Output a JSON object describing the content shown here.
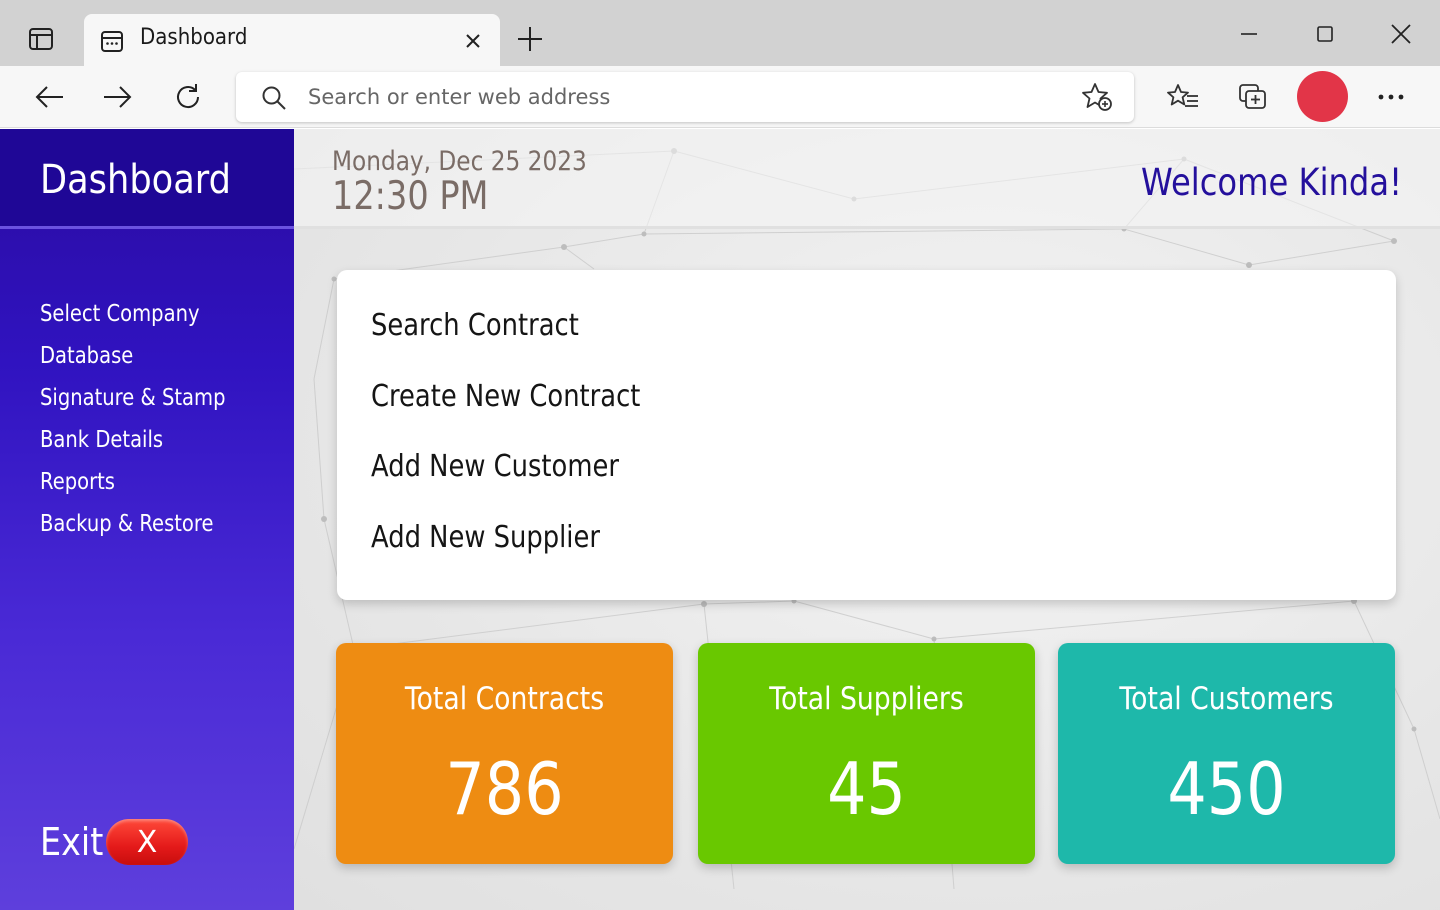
{
  "browser": {
    "tab_title": "Dashboard",
    "address_placeholder": "Search or enter web address",
    "profile_color": "#e23548"
  },
  "sidebar": {
    "title": "Dashboard",
    "items": [
      {
        "label": "Select Company"
      },
      {
        "label": "Database"
      },
      {
        "label": "Signature & Stamp"
      },
      {
        "label": "Bank Details"
      },
      {
        "label": "Reports"
      },
      {
        "label": "Backup & Restore"
      }
    ],
    "exit_label": "Exit",
    "exit_badge": "X"
  },
  "header": {
    "date": "Monday, Dec 25 2023",
    "time": "12:30 PM",
    "welcome": "Welcome Kinda!"
  },
  "actions": [
    {
      "label": "Search Contract"
    },
    {
      "label": "Create New Contract"
    },
    {
      "label": "Add New Customer"
    },
    {
      "label": "Add New Supplier"
    }
  ],
  "stats": [
    {
      "label": "Total Contracts",
      "value": "786",
      "color": "#ee8c12"
    },
    {
      "label": "Total Suppliers",
      "value": "45",
      "color": "#69c800"
    },
    {
      "label": "Total Customers",
      "value": "450",
      "color": "#1eb8aa"
    }
  ]
}
